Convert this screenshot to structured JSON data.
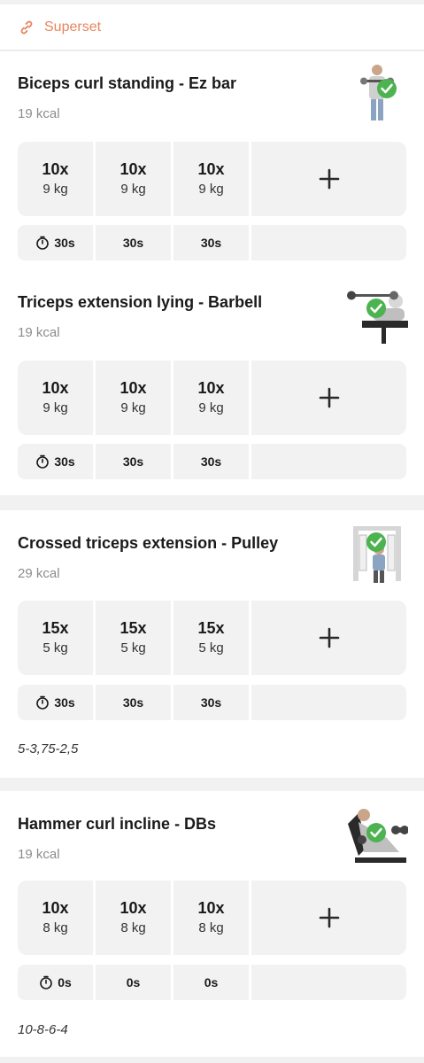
{
  "superset": {
    "label": "Superset",
    "icon": "link-icon",
    "color": "#e8845d"
  },
  "exercises": [
    {
      "title": "Biceps curl standing - Ez bar",
      "kcal": "19 kcal",
      "sets": [
        {
          "reps": "10x",
          "weight": "9 kg"
        },
        {
          "reps": "10x",
          "weight": "9 kg"
        },
        {
          "reps": "10x",
          "weight": "9 kg"
        }
      ],
      "rests": [
        "30s",
        "30s",
        "30s"
      ],
      "note": ""
    },
    {
      "title": "Triceps extension lying - Barbell",
      "kcal": "19 kcal",
      "sets": [
        {
          "reps": "10x",
          "weight": "9 kg"
        },
        {
          "reps": "10x",
          "weight": "9 kg"
        },
        {
          "reps": "10x",
          "weight": "9 kg"
        }
      ],
      "rests": [
        "30s",
        "30s",
        "30s"
      ],
      "note": ""
    },
    {
      "title": "Crossed triceps extension - Pulley",
      "kcal": "29 kcal",
      "sets": [
        {
          "reps": "15x",
          "weight": "5 kg"
        },
        {
          "reps": "15x",
          "weight": "5 kg"
        },
        {
          "reps": "15x",
          "weight": "5 kg"
        }
      ],
      "rests": [
        "30s",
        "30s",
        "30s"
      ],
      "note": "5-3,75-2,5"
    },
    {
      "title": "Hammer curl incline - DBs",
      "kcal": "19 kcal",
      "sets": [
        {
          "reps": "10x",
          "weight": "8 kg"
        },
        {
          "reps": "10x",
          "weight": "8 kg"
        },
        {
          "reps": "10x",
          "weight": "8 kg"
        }
      ],
      "rests": [
        "0s",
        "0s",
        "0s"
      ],
      "note": "10-8-6-4"
    }
  ],
  "icons": {
    "add": "plus-icon",
    "timer": "stopwatch-icon",
    "completed": "checkmark-icon"
  },
  "colors": {
    "check": "#4cb350",
    "accent": "#e8845d",
    "cell": "#f2f2f2"
  }
}
